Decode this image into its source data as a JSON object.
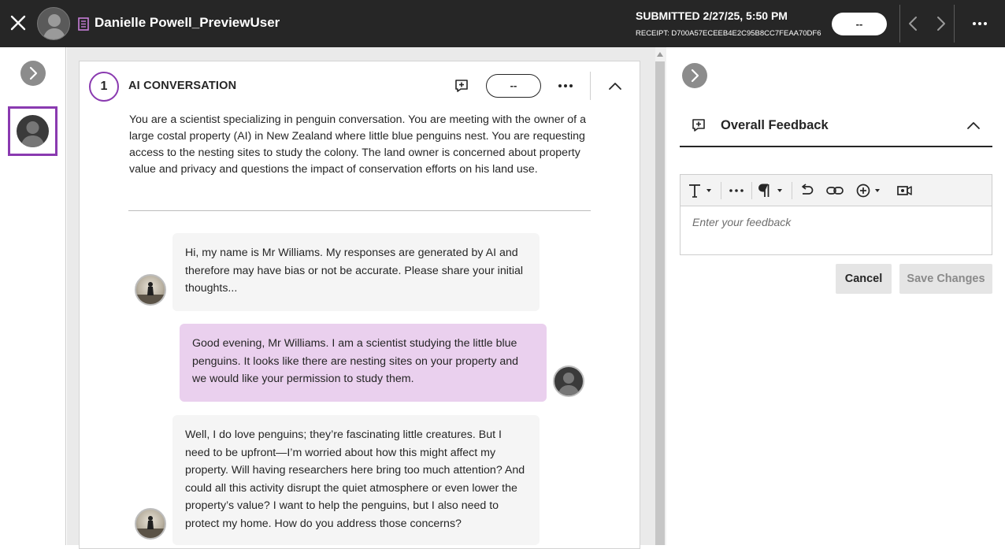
{
  "header": {
    "student_name": "Danielle Powell_PreviewUser",
    "submitted": "SUBMITTED 2/27/25, 5:50 PM",
    "receipt": "RECEIPT: D700A57ECEEB4E2C95B8CC7FEAA70DF6",
    "grade": "--"
  },
  "question": {
    "number": "1",
    "title": "AI CONVERSATION",
    "grade": "--",
    "prompt": "You are a scientist specializing in penguin conversation. You are meeting with the owner of a large costal property (AI) in New Zealand where little blue penguins nest. You are requesting access to the nesting sites to study the colony. The land owner is concerned about property value and privacy and questions the impact of conservation efforts on his land use."
  },
  "messages": [
    {
      "role": "ai",
      "text": "Hi, my name is Mr Williams. My responses are generated by AI and therefore may have bias or not be accurate. Please share your initial thoughts..."
    },
    {
      "role": "user",
      "text": "Good evening, Mr Williams. I am a scientist studying the little blue penguins. It looks like there are nesting sites on your property and we would like your permission to study them."
    },
    {
      "role": "ai",
      "text": "Well, I do love penguins; they’re fascinating little creatures. But I need to be upfront—I’m worried about how this might affect my property. Will having researchers here bring too much attention? And could all this activity disrupt the quiet atmosphere or even lower the property’s value? I want to help the penguins, but I also need to protect my home. How do you address those concerns?"
    }
  ],
  "feedback": {
    "title": "Overall Feedback",
    "placeholder": "Enter your feedback",
    "cancel_label": "Cancel",
    "save_label": "Save Changes"
  },
  "colors": {
    "accent": "#8a3ab0",
    "user_bubble": "#ead0ee",
    "ai_bubble": "#f5f5f5",
    "topbar": "#262626"
  }
}
